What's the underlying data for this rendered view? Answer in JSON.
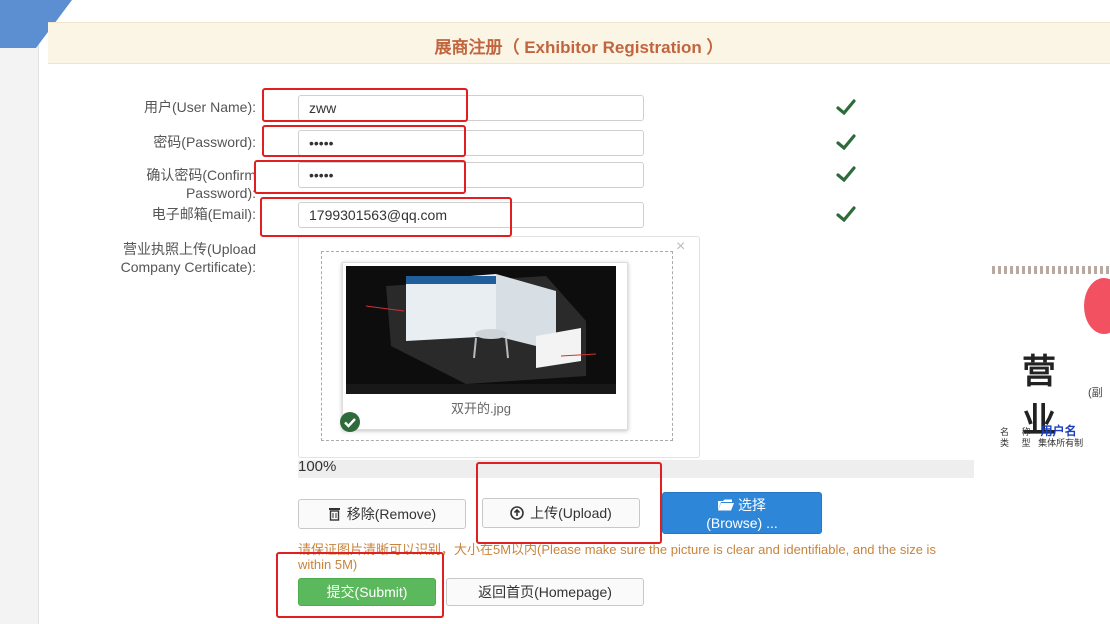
{
  "header": {
    "title": "展商注册（ Exhibitor Registration ）"
  },
  "form": {
    "username": {
      "label": "用户(User Name):",
      "value": "zww"
    },
    "password": {
      "label": "密码(Password):",
      "value": "•••••"
    },
    "confirm": {
      "label_line1": "确认密码(Confirm",
      "label_line2": "Password):",
      "value": "•••••"
    },
    "email": {
      "label": "电子邮箱(Email):",
      "value": "1799301563@qq.com"
    },
    "upload": {
      "label_line1": "营业执照上传(Upload",
      "label_line2": "Company Certificate):"
    }
  },
  "uploader": {
    "close_glyph": "×",
    "file_name": "双开的.jpg",
    "progress_text": "100%",
    "progress_value": 1.0,
    "remove_label": "移除(Remove)",
    "upload_label": "上传(Upload)",
    "browse_line1": "选择",
    "browse_line2": "(Browse) ...",
    "hint": "请保证图片清晰可以识别，大小在5M以内(Please make sure the picture is clear and identifiable, and the size is within 5M)"
  },
  "actions": {
    "submit_label": "提交(Submit)",
    "homepage_label": "返回首页(Homepage)"
  },
  "certificate_preview": {
    "title": "营 业",
    "subtitle": "(副",
    "row1_key": "名",
    "row1_key2": "称",
    "row1_value": "用户名",
    "row2_key": "类",
    "row2_key2": "型",
    "row2_value": "集体所有制"
  },
  "colors": {
    "header_text": "#c1653e",
    "check_green": "#2f6b3a",
    "annotation_red": "#e02020",
    "browse_blue": "#2e86d9",
    "submit_green": "#5cb85c",
    "hint_orange": "#c8843c"
  },
  "icons": [
    "check-icon",
    "trash-icon",
    "upload-circle-icon",
    "folder-icon",
    "success-check-icon",
    "close-icon"
  ]
}
